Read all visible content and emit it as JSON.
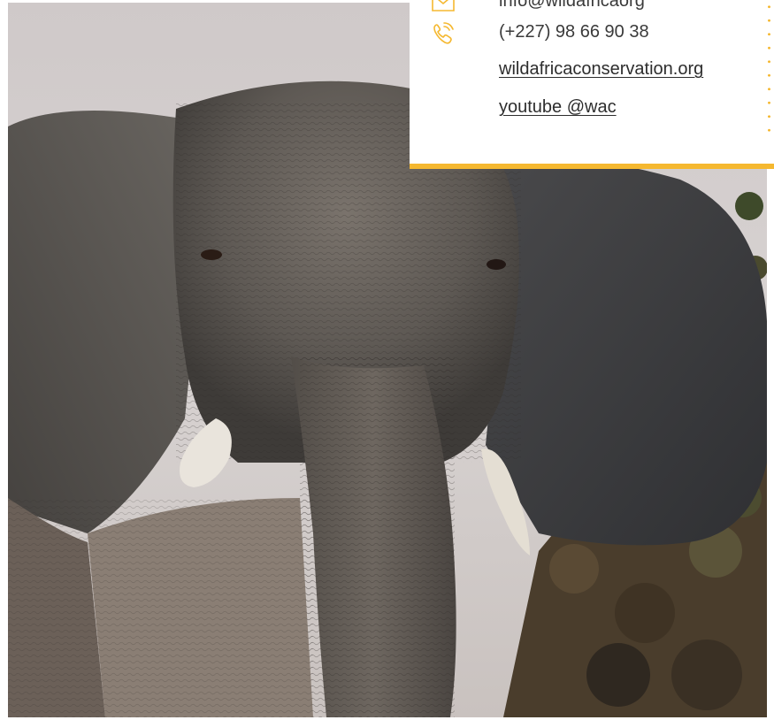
{
  "contact": {
    "email_partial": "info@wildafricaorg",
    "phone": "(+227) 98 66 90 38",
    "website": "wildafricaconservation.org",
    "youtube": "youtube @wac"
  },
  "icons": {
    "email": "envelope-icon",
    "phone": "phone-ringing-icon"
  },
  "colors": {
    "accent": "#f5b830",
    "text": "#3a3a3a"
  }
}
